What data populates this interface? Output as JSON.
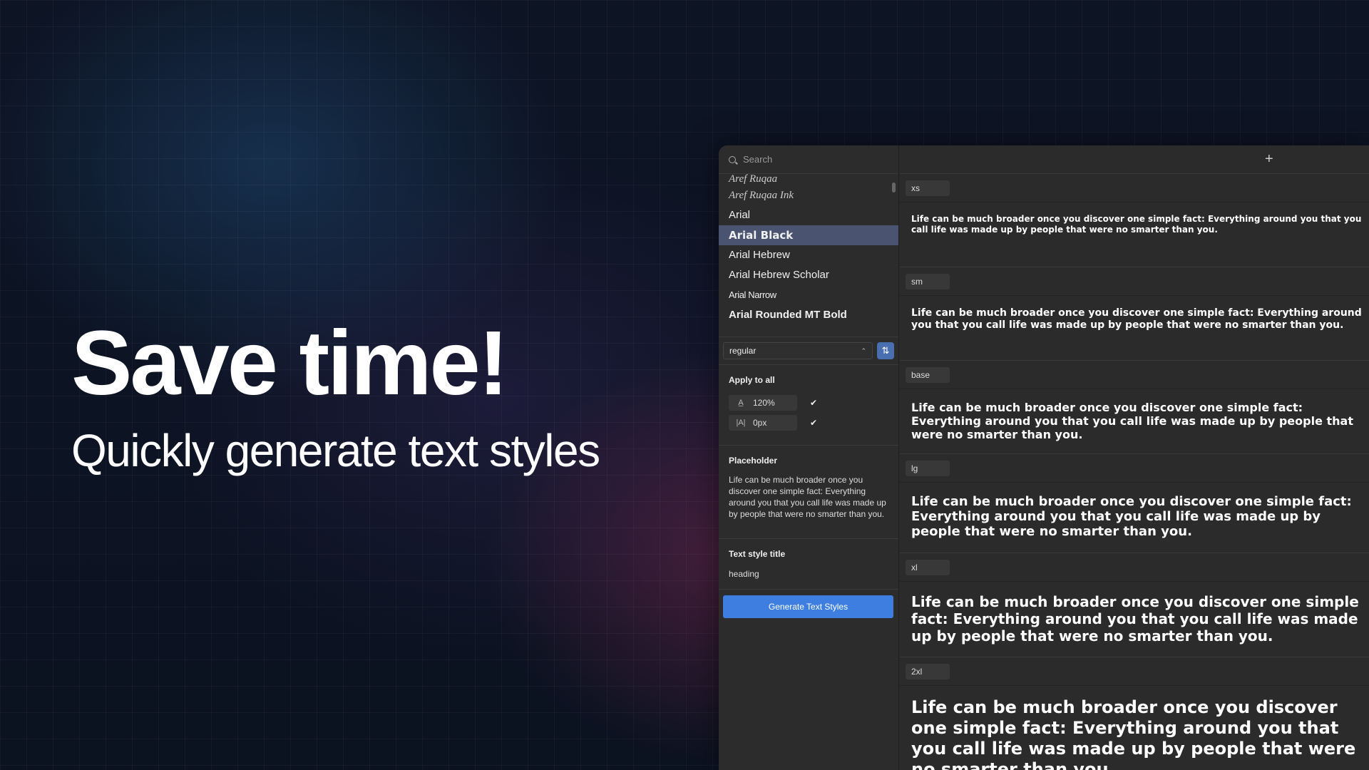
{
  "hero": {
    "title": "Save time!",
    "subtitle": "Quickly generate text styles"
  },
  "search": {
    "placeholder": "Search"
  },
  "fonts": [
    {
      "label": "Aref Ruqaa"
    },
    {
      "label": "Aref Ruqaa Ink"
    },
    {
      "label": "Arial"
    },
    {
      "label": "Arial Black"
    },
    {
      "label": "Arial Hebrew"
    },
    {
      "label": "Arial Hebrew Scholar"
    },
    {
      "label": "Arial Narrow"
    },
    {
      "label": "Arial Rounded MT Bold"
    }
  ],
  "weight": {
    "value": "regular"
  },
  "apply_all": {
    "title": "Apply to all",
    "line_height": "120%",
    "letter_spacing": "0px"
  },
  "placeholder_section": {
    "title": "Placeholder",
    "text": "Life can be much broader once you discover one simple fact: Everything around you that you call life was made up by people that were no smarter than you."
  },
  "text_style_title": {
    "title": "Text style title",
    "value": "heading"
  },
  "generate_button": {
    "label": "Generate Text Styles"
  },
  "styles": [
    {
      "tag": "xs",
      "sample": "Life can be much broader once you discover one simple fact: Everything around you that you call life was made up by people that were no smarter than you."
    },
    {
      "tag": "sm",
      "sample": "Life can be much broader once you discover one simple fact: Everything around you that you call life was made up by people that were no smarter than you."
    },
    {
      "tag": "base",
      "sample": "Life can be much broader once you discover one simple fact: Everything around you that you call life was made up by people that were no smarter than you."
    },
    {
      "tag": "lg",
      "sample": "Life can be much broader once you discover one simple fact: Everything around you that you call life was made up by people that were no smarter than you."
    },
    {
      "tag": "xl",
      "sample": "Life can be much broader once you discover one simple fact: Everything around you that you call life was made up by people that were no smarter than you."
    },
    {
      "tag": "2xl",
      "sample": "Life can be much broader once you discover one simple fact: Everything around you that you call life was made up by people that were no smarter than you."
    }
  ]
}
